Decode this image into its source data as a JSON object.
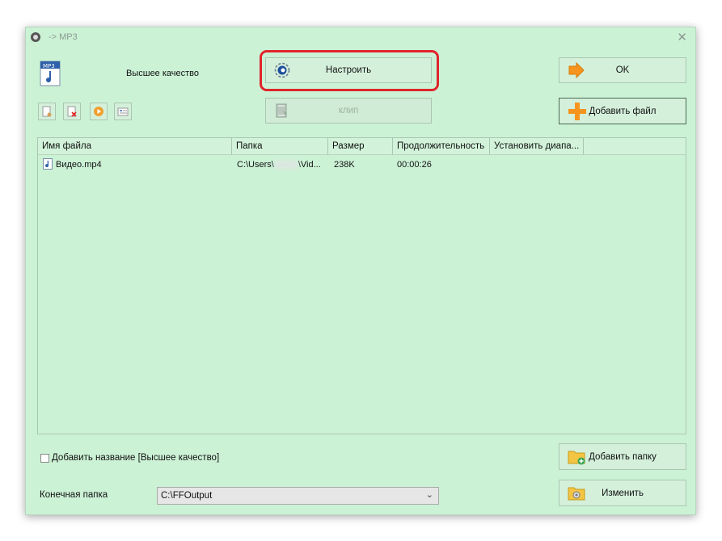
{
  "window": {
    "title": "-> MP3"
  },
  "profile": {
    "quality_label": "Высшее качество"
  },
  "buttons": {
    "setup": "Настроить",
    "clip": "клип",
    "ok": "OK",
    "add_file": "Добавить файл",
    "add_folder": "Добавить папку",
    "change": "Изменить"
  },
  "file_list": {
    "columns": [
      "Имя файла",
      "Папка",
      "Размер",
      "Продолжительность",
      "Установить диапа..."
    ],
    "rows": [
      {
        "name": "Видео.mp4",
        "folder_prefix": "C:\\Users\\",
        "folder_suffix": "\\Vid...",
        "size": "238K",
        "duration": "00:00:26"
      }
    ]
  },
  "options": {
    "add_title_label": "Добавить название [Высшее качество]"
  },
  "destination": {
    "label": "Конечная папка",
    "value": "C:\\FFOutput"
  },
  "colors": {
    "window_bg": "#ccf2d6",
    "highlight": "#e0252a",
    "accent": "#f7941d"
  }
}
